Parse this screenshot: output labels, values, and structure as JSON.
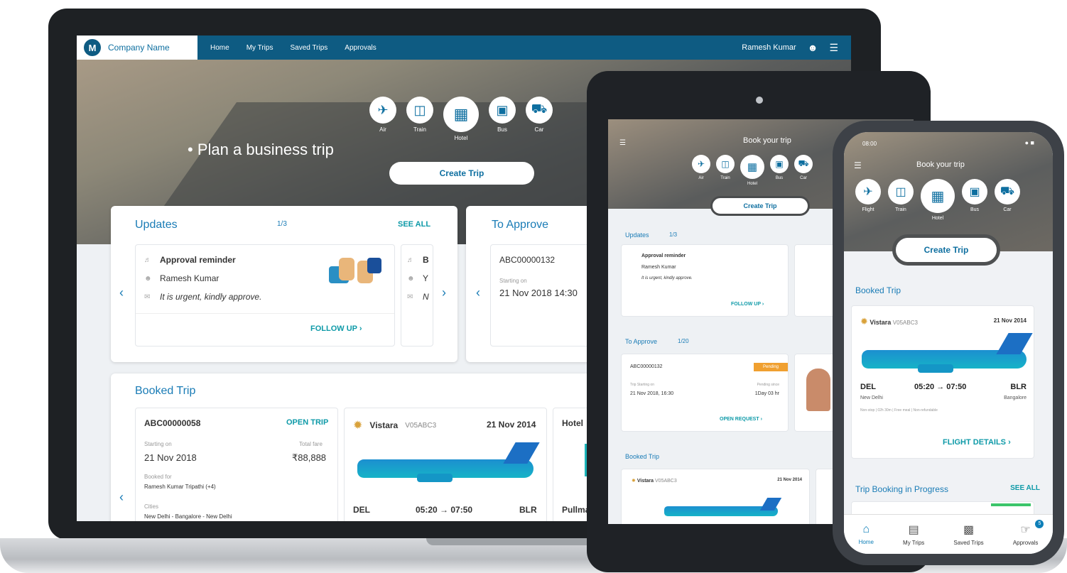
{
  "laptop": {
    "nav": {
      "brand": "Company Name",
      "links": [
        "Home",
        "My Trips",
        "Saved Trips",
        "Approvals"
      ],
      "user": "Ramesh Kumar"
    },
    "hero": {
      "title": "Plan a business trip",
      "modes": [
        "Air",
        "Train",
        "Hotel",
        "Bus",
        "Car"
      ],
      "create_trip": "Create Trip"
    },
    "updates": {
      "title": "Updates",
      "pager": "1/3",
      "see_all": "SEE ALL",
      "item": {
        "title": "Approval reminder",
        "person": "Ramesh Kumar",
        "message": "It is urgent, kindly approve.",
        "action": "FOLLOW UP"
      },
      "peek": [
        "B",
        "Y",
        "N"
      ]
    },
    "to_approve": {
      "title": "To Approve",
      "id": "ABC00000132",
      "starting_label": "Starting on",
      "date": "21 Nov 2018  14:30"
    },
    "booked": {
      "title": "Booked Trip",
      "trip": {
        "id": "ABC00000058",
        "action": "OPEN TRIP",
        "starting_label": "Starting on",
        "date": "21 Nov 2018",
        "total_label": "Total fare",
        "total": "₹88,888",
        "booked_for_label": "Booked for",
        "booked_for": "Ramesh Kumar Tripathi (+4)",
        "cities_label": "Cities",
        "cities": "New Delhi - Bangalore - New Delhi"
      },
      "flight": {
        "airline": "Vistara",
        "code": "V05ABC3",
        "date": "21 Nov 2014",
        "from": "DEL",
        "time": "05:20  →  07:50",
        "to": "BLR"
      },
      "hotel": {
        "title": "Hotel",
        "name": "Pullma"
      }
    }
  },
  "tablet": {
    "hero_title": "Book your trip",
    "modes": [
      "Air",
      "Train",
      "Hotel",
      "Bus",
      "Car"
    ],
    "create_trip": "Create Trip",
    "updates": {
      "title": "Updates",
      "pager": "1/3",
      "item": {
        "title": "Approval reminder",
        "person": "Ramesh Kumar",
        "message": "It is urgent, kindly approve.",
        "action": "FOLLOW UP"
      }
    },
    "to_approve": {
      "title": "To Approve",
      "pager": "1/20",
      "id": "ABC00000132",
      "badge": "Pending",
      "starting_label": "Trip Starting on",
      "date": "21 Nov 2018, 16:30",
      "pending_label": "Pending since",
      "pending": "1Day 03 hr",
      "action": "OPEN REQUEST"
    },
    "booked": {
      "title": "Booked Trip",
      "airline": "Vistara",
      "code": "V05ABC3",
      "date": "21 Nov 2014"
    }
  },
  "phone": {
    "status_time": "08:00",
    "hero_title": "Book your trip",
    "modes": [
      "Flight",
      "Train",
      "Hotel",
      "Bus",
      "Car"
    ],
    "create_trip": "Create Trip",
    "booked": {
      "title": "Booked Trip",
      "airline": "Vistara",
      "code": "V05ABC3",
      "date": "21 Nov 2014",
      "from": "DEL",
      "from_city": "New Delhi",
      "time": "05:20  →  07:50",
      "to": "BLR",
      "to_city": "Bangalore",
      "details": "Non-stop | 02h 30m | Free meal | Non-refundable",
      "action": "FLIGHT DETAILS"
    },
    "in_progress": {
      "title": "Trip Booking in Progress",
      "see_all": "SEE ALL"
    },
    "tabs": [
      "Home",
      "My Trips",
      "Saved Trips",
      "Approvals"
    ],
    "approvals_badge": "5"
  },
  "colors": {
    "primary": "#0e5b82",
    "accent": "#1a7cb6",
    "teal": "#0e9aa8"
  }
}
